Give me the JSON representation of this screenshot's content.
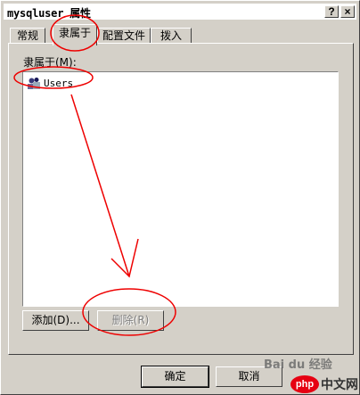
{
  "window": {
    "title": "mysqluser 属性",
    "help_label": "?",
    "close_label": "×"
  },
  "tabs": [
    {
      "label": "常规",
      "active": false
    },
    {
      "label": "隶属于",
      "active": true
    },
    {
      "label": "配置文件",
      "active": false
    },
    {
      "label": "拨入",
      "active": false
    }
  ],
  "member_of": {
    "label": "隶属于(M):",
    "items": [
      {
        "name": "Users",
        "icon": "user-group-icon"
      }
    ]
  },
  "buttons": {
    "add": "添加(D)...",
    "remove": "删除(R)",
    "ok": "确定",
    "cancel": "取消"
  },
  "watermark": {
    "baidu": "Bai du 经验",
    "php": "php",
    "site": "中文网"
  }
}
